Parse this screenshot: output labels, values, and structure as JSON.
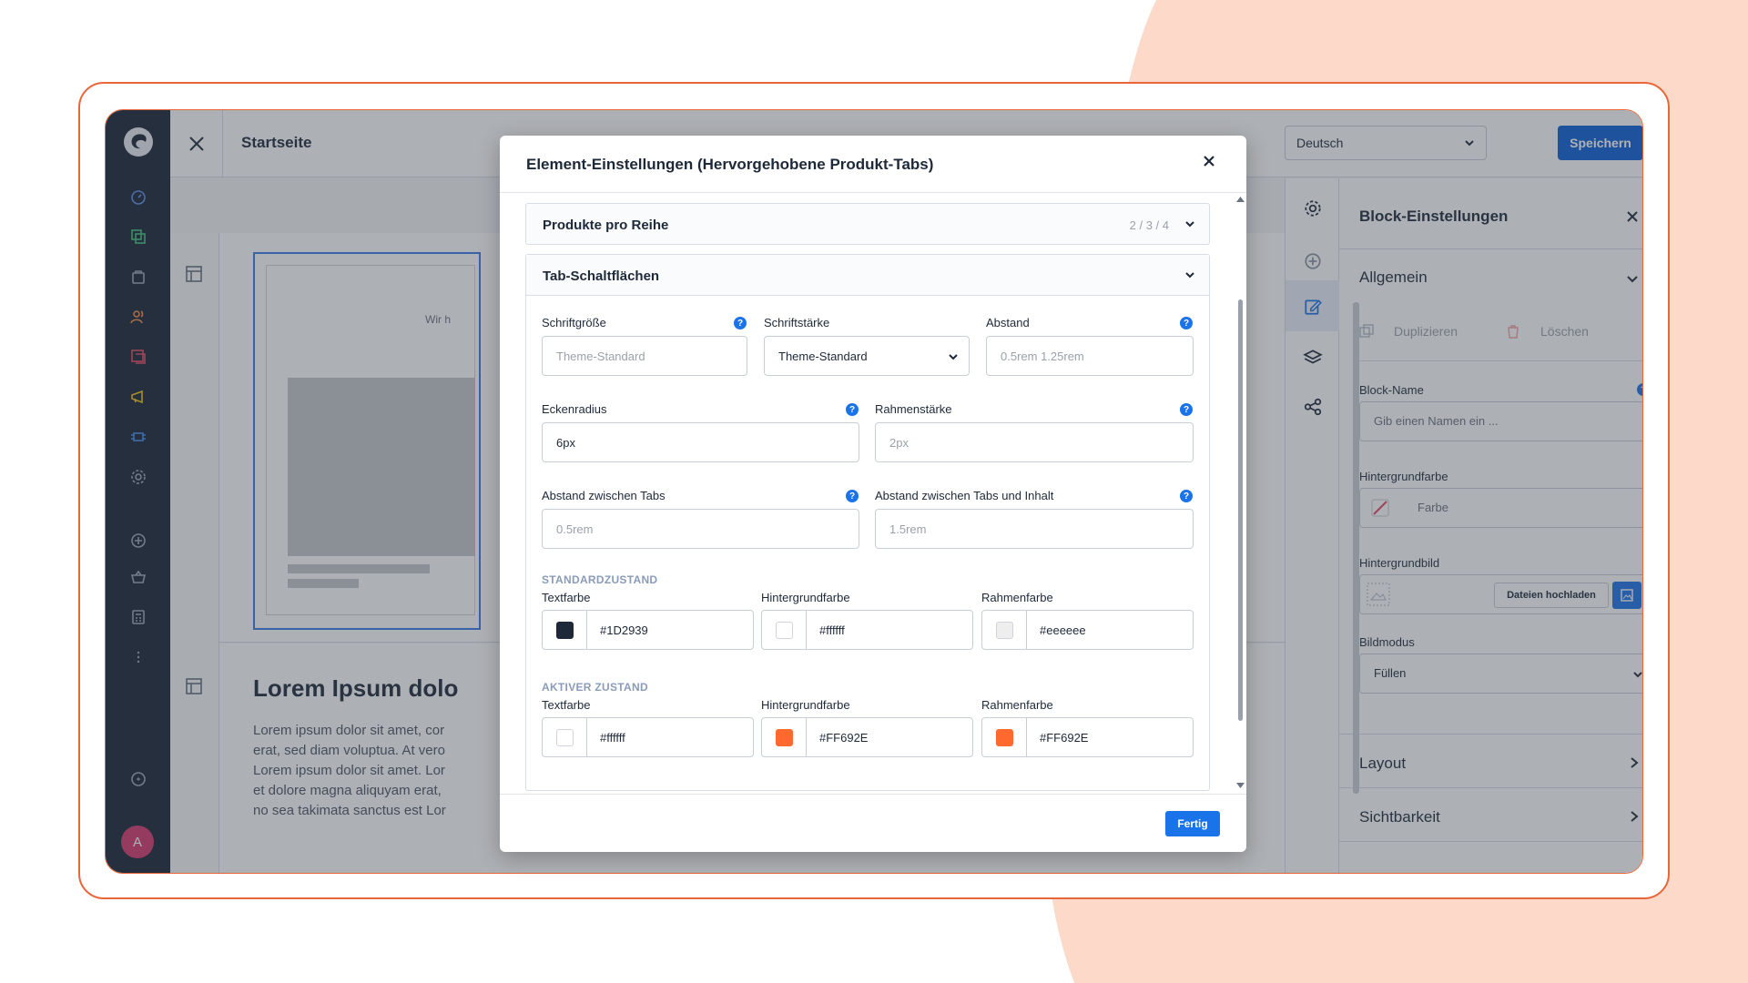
{
  "app": {
    "page_title": "Startseite",
    "language": "Deutsch",
    "save_label": "Speichern",
    "avatar_initial": "A"
  },
  "canvas": {
    "teaser_text": "Wir h",
    "heading": "Lorem Ipsum dolo",
    "paragraph_lines": [
      "Lorem ipsum dolor sit amet, cor",
      "erat, sed diam voluptua. At vero",
      "Lorem ipsum dolor sit amet. Lor",
      "et dolore magna aliquyam erat,",
      "no sea takimata sanctus est Lor"
    ]
  },
  "right_panel": {
    "title": "Block-Einstellungen",
    "section_general": "Allgemein",
    "duplicate_label": "Duplizieren",
    "delete_label": "Löschen",
    "block_name_label": "Block-Name",
    "block_name_placeholder": "Gib einen Namen ein ...",
    "bg_color_label": "Hintergrundfarbe",
    "bg_color_value": "Farbe",
    "bg_image_label": "Hintergrundbild",
    "upload_label": "Dateien hochladen",
    "image_mode_label": "Bildmodus",
    "image_mode_value": "Füllen",
    "section_layout": "Layout",
    "section_visibility": "Sichtbarkeit"
  },
  "modal": {
    "title": "Element-Einstellungen (Hervorgehobene Produkt-Tabs)",
    "products_per_row": {
      "title": "Produkte pro Reihe",
      "meta": "2 / 3 / 4"
    },
    "tab_buttons": {
      "title": "Tab-Schaltflächen",
      "font_size_label": "Schriftgröße",
      "font_size_placeholder": "Theme-Standard",
      "font_weight_label": "Schriftstärke",
      "font_weight_value": "Theme-Standard",
      "padding_label": "Abstand",
      "padding_placeholder": "0.5rem 1.25rem",
      "radius_label": "Eckenradius",
      "radius_value": "6px",
      "border_width_label": "Rahmenstärke",
      "border_width_placeholder": "2px",
      "tab_gap_label": "Abstand zwischen Tabs",
      "tab_gap_placeholder": "0.5rem",
      "tab_content_gap_label": "Abstand zwischen Tabs und Inhalt",
      "tab_content_gap_placeholder": "1.5rem"
    },
    "default_state": {
      "heading": "STANDARDZUSTAND",
      "text_color_label": "Textfarbe",
      "text_color": "#1D2939",
      "bg_color_label": "Hintergrundfarbe",
      "bg_color": "#ffffff",
      "border_color_label": "Rahmenfarbe",
      "border_color": "#eeeeee"
    },
    "active_state": {
      "heading": "AKTIVER ZUSTAND",
      "text_color_label": "Textfarbe",
      "text_color": "#ffffff",
      "bg_color_label": "Hintergrundfarbe",
      "bg_color": "#FF692E",
      "border_color_label": "Rahmenfarbe",
      "border_color": "#FF692E"
    },
    "done_label": "Fertig",
    "help_glyph": "?"
  },
  "colors": {
    "accent": "#1a73e8",
    "brand_orange": "#e8663a",
    "nav_bg": "#182235",
    "overlay_bg_shape": "#fdd9c9"
  }
}
